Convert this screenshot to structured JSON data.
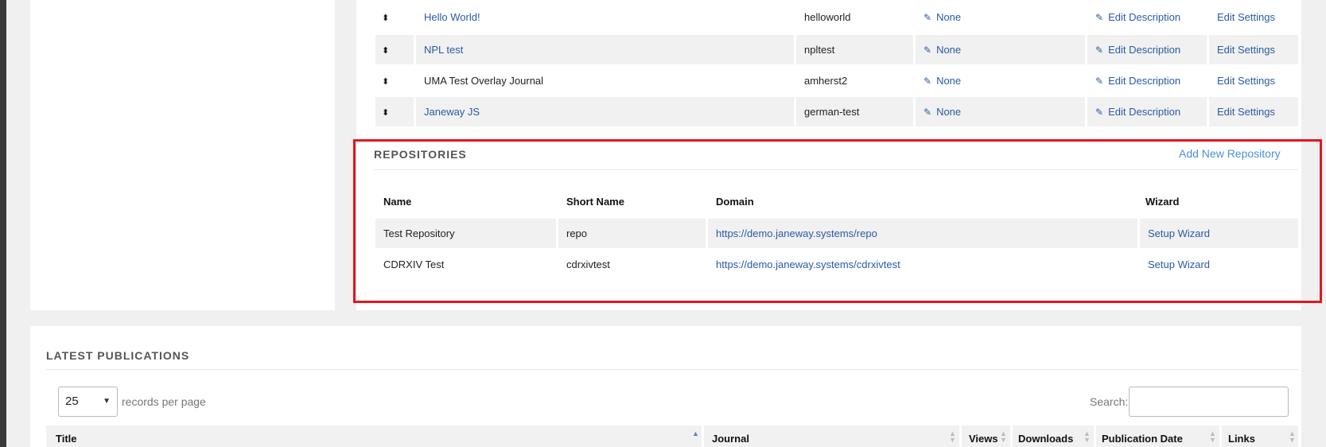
{
  "journals": {
    "rows": [
      {
        "name": "Hello World!",
        "code": "helloworld",
        "domain": "None",
        "description": "Edit Description",
        "settings": "Edit Settings",
        "name_is_link": true
      },
      {
        "name": "NPL test",
        "code": "npltest",
        "domain": "None",
        "description": "Edit Description",
        "settings": "Edit Settings",
        "name_is_link": true
      },
      {
        "name": "UMA Test Overlay Journal",
        "code": "amherst2",
        "domain": "None",
        "description": "Edit Description",
        "settings": "Edit Settings",
        "name_is_link": false
      },
      {
        "name": "Janeway JS",
        "code": "german-test",
        "domain": "None",
        "description": "Edit Description",
        "settings": "Edit Settings",
        "name_is_link": true
      }
    ]
  },
  "repositories": {
    "title": "REPOSITORIES",
    "add_label": "Add New Repository",
    "headers": {
      "name": "Name",
      "short_name": "Short Name",
      "domain": "Domain",
      "wizard": "Wizard"
    },
    "rows": [
      {
        "name": "Test Repository",
        "short_name": "repo",
        "domain": "https://demo.janeway.systems/repo",
        "wizard": "Setup Wizard"
      },
      {
        "name": "CDRXIV Test",
        "short_name": "cdrxivtest",
        "domain": "https://demo.janeway.systems/cdrxivtest",
        "wizard": "Setup Wizard"
      }
    ]
  },
  "publications": {
    "title": "LATEST PUBLICATIONS",
    "records_value": "25",
    "records_label": "records per page",
    "search_label": "Search:",
    "search_value": "",
    "headers": {
      "title": "Title",
      "journal": "Journal",
      "views": "Views",
      "downloads": "Downloads",
      "publication_date": "Publication Date",
      "links": "Links"
    }
  },
  "colors": {
    "link": "#2a5aa8",
    "accent_link": "#4a90d9",
    "highlight": "#e3161d",
    "stripe": "#f1f1f1"
  },
  "icons": {
    "sort": "sort-icon",
    "edit": "edit-icon",
    "dropdown": "chevron-down-icon"
  }
}
